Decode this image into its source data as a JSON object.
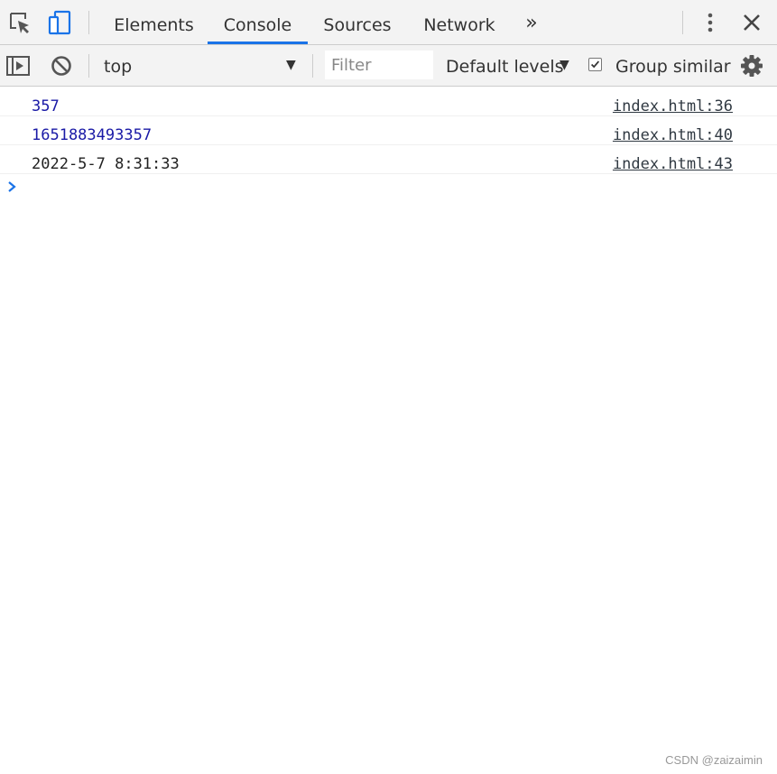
{
  "tabbar": {
    "tabs": [
      {
        "label": "Elements"
      },
      {
        "label": "Console"
      },
      {
        "label": "Sources"
      },
      {
        "label": "Network"
      }
    ],
    "active_tab": "Console",
    "more_tabs_glyph": "»",
    "icons": [
      "inspect-element-icon",
      "device-toolbar-icon",
      "kebab-menu-icon",
      "close-icon"
    ],
    "accent_color": "#1a73e8"
  },
  "toolbar": {
    "context": "top",
    "filter_placeholder": "Filter",
    "filter_value": "",
    "levels": "Default levels",
    "group_similar_label": "Group similar",
    "group_similar_checked": true,
    "icons": [
      "sidebar-toggle-icon",
      "clear-console-icon",
      "settings-gear-icon"
    ]
  },
  "console": {
    "messages": [
      {
        "text": "357",
        "source": "index.html:36",
        "kind": "number"
      },
      {
        "text": "1651883493357",
        "source": "index.html:40",
        "kind": "number"
      },
      {
        "text": "2022-5-7 8:31:33",
        "source": "index.html:43",
        "kind": "string"
      }
    ],
    "prompt_glyph": "›"
  },
  "watermark": "CSDN @zaizaimin"
}
